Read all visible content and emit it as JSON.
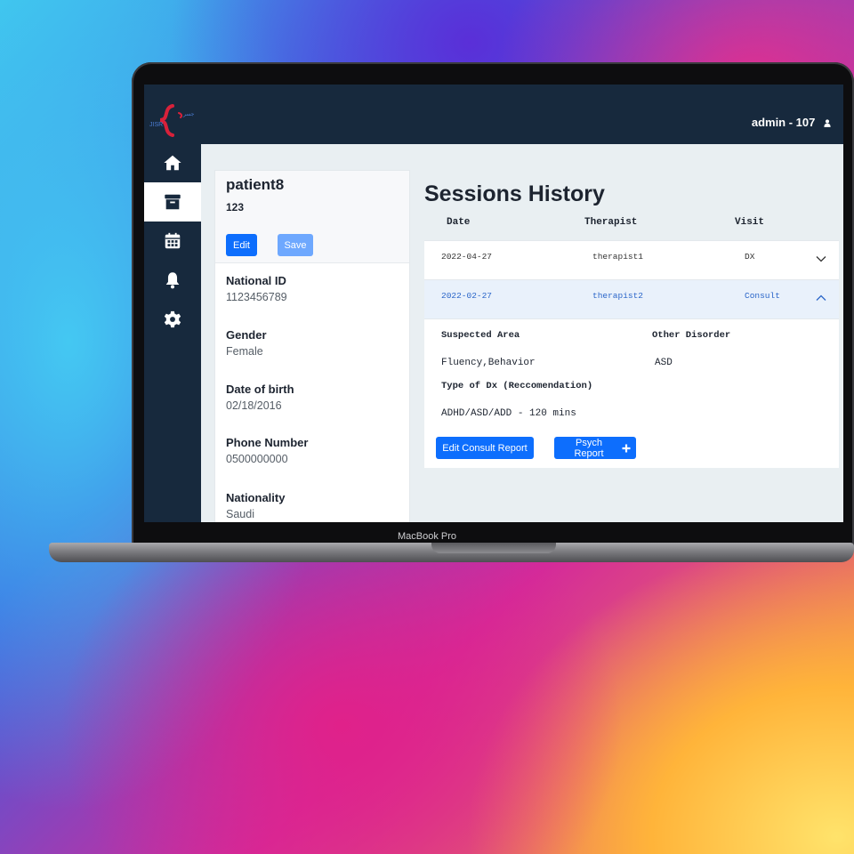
{
  "device": {
    "label": "MacBook Pro"
  },
  "header": {
    "user": "admin - 107",
    "logo_text": "JISR"
  },
  "sidebar": {
    "items": [
      {
        "name": "home",
        "icon": "home-icon"
      },
      {
        "name": "archive",
        "icon": "archive-icon",
        "active": true
      },
      {
        "name": "calendar",
        "icon": "calendar-icon"
      },
      {
        "name": "notifications",
        "icon": "bell-icon"
      },
      {
        "name": "settings",
        "icon": "gear-icon"
      }
    ]
  },
  "patient": {
    "name": "patient8",
    "code": "123",
    "edit_label": "Edit",
    "save_label": "Save",
    "fields": [
      {
        "label": "National ID",
        "value": "1123456789"
      },
      {
        "label": "Gender",
        "value": "Female"
      },
      {
        "label": "Date of birth",
        "value": "02/18/2016"
      },
      {
        "label": "Phone Number",
        "value": "0500000000"
      },
      {
        "label": "Nationality",
        "value": "Saudi"
      }
    ]
  },
  "sessions": {
    "title": "Sessions History",
    "columns": [
      "Date",
      "Therapist",
      "Visit"
    ],
    "rows": [
      {
        "date": "2022-04-27",
        "therapist": "therapist1",
        "visit": "DX",
        "expanded": false
      },
      {
        "date": "2022-02-27",
        "therapist": "therapist2",
        "visit": "Consult",
        "expanded": true
      }
    ],
    "details": {
      "suspected_area_label": "Suspected Area",
      "suspected_area_value": "Fluency,Behavior",
      "other_disorder_label": "Other Disorder",
      "other_disorder_value": "ASD",
      "dx_type_label": "Type of Dx (Reccomendation)",
      "dx_type_value": "ADHD/ASD/ADD - 120 mins",
      "edit_report_label": "Edit Consult Report",
      "psych_report_label": "Psych Report"
    }
  },
  "colors": {
    "sidebar": "#17293d",
    "primary": "#0d6efd",
    "accent_red": "#d8213a"
  }
}
